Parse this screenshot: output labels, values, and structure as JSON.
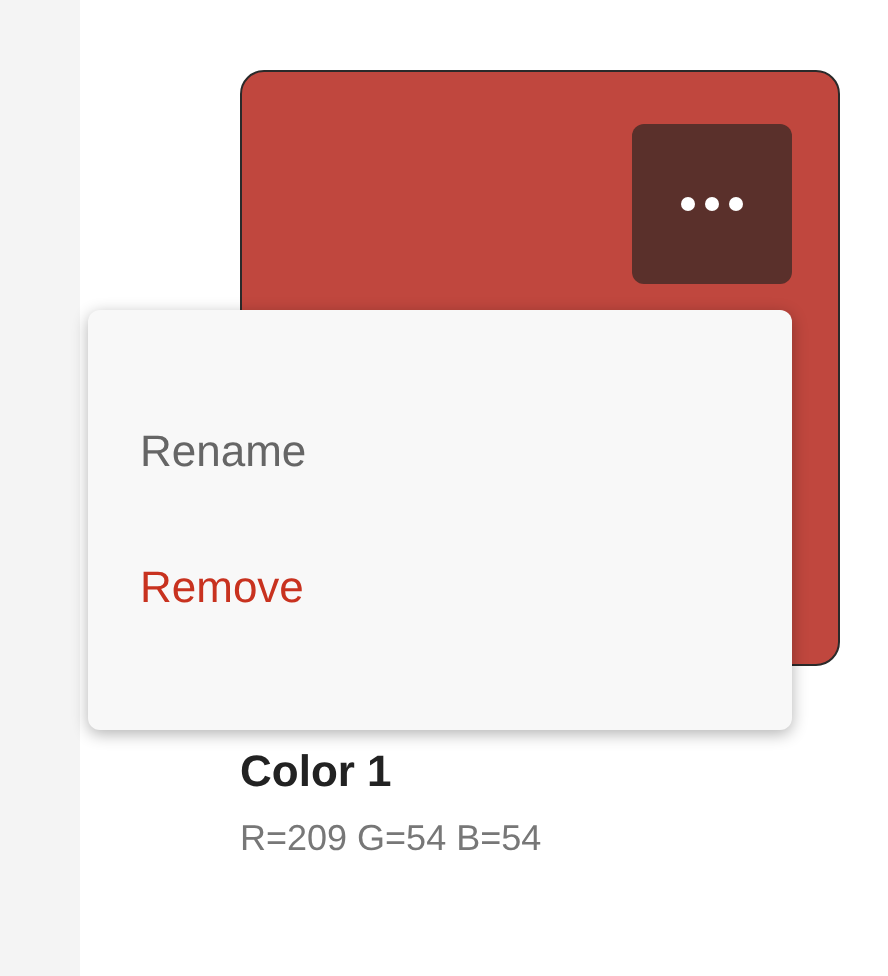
{
  "swatch": {
    "color": "#c0473e",
    "name": "Color 1",
    "values": "R=209 G=54 B=54"
  },
  "menu": {
    "open": true,
    "items": [
      {
        "label": "Rename",
        "kind": "normal"
      },
      {
        "label": "Remove",
        "kind": "destructive"
      }
    ]
  }
}
